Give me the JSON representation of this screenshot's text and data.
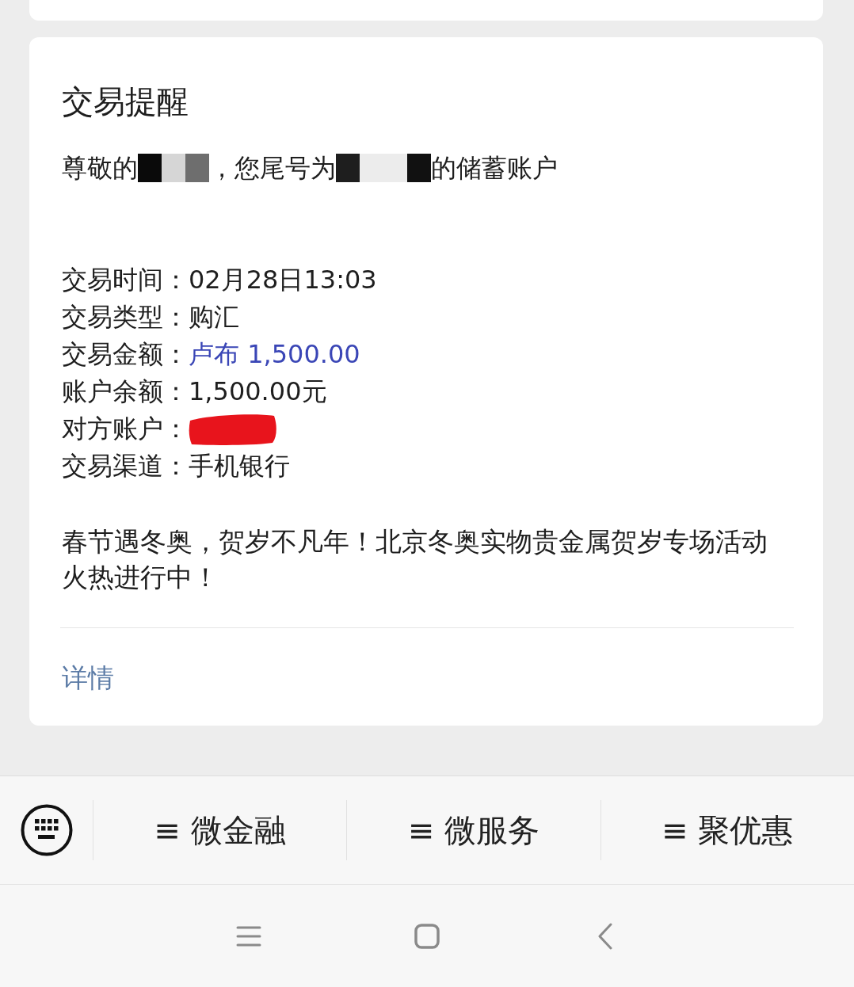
{
  "message": {
    "title": "交易提醒",
    "greeting": [
      {
        "kind": "text",
        "text": "尊敬的"
      },
      {
        "kind": "redaction",
        "blocks": [
          {
            "color": "#0a0a0a"
          },
          {
            "color": "#d6d6d6"
          },
          {
            "color": "#6e6e6e"
          }
        ]
      },
      {
        "kind": "text",
        "text": "，您尾号为"
      },
      {
        "kind": "redaction",
        "blocks": [
          {
            "color": "#1e1e1e"
          },
          {
            "color": "#ececec"
          },
          {
            "color": "#ececec"
          },
          {
            "color": "#111111"
          }
        ]
      },
      {
        "kind": "text",
        "text": "的储蓄账户"
      }
    ],
    "details": [
      {
        "kind": "text",
        "label": "交易时间：",
        "value": "02月28日13:03"
      },
      {
        "kind": "text",
        "label": "交易类型：",
        "value": "购汇"
      },
      {
        "kind": "highlight",
        "label": "交易金额：",
        "value": "卢布 1,500.00"
      },
      {
        "kind": "text",
        "label": "账户余额：",
        "value": "1,500.00元"
      },
      {
        "kind": "redacted",
        "label": "对方账户：",
        "color": "#e8141c"
      },
      {
        "kind": "text",
        "label": "交易渠道：",
        "value": "手机银行"
      }
    ],
    "promo": "春节遇冬奥，贺岁不凡年！北京冬奥实物贵金属贺岁专场活动火热进行中！",
    "link": "详情"
  },
  "menu_bar": {
    "items": [
      {
        "label": "≡ 微金融"
      },
      {
        "label": "≡ 微服务"
      },
      {
        "label": "≡ 聚优惠"
      }
    ]
  }
}
